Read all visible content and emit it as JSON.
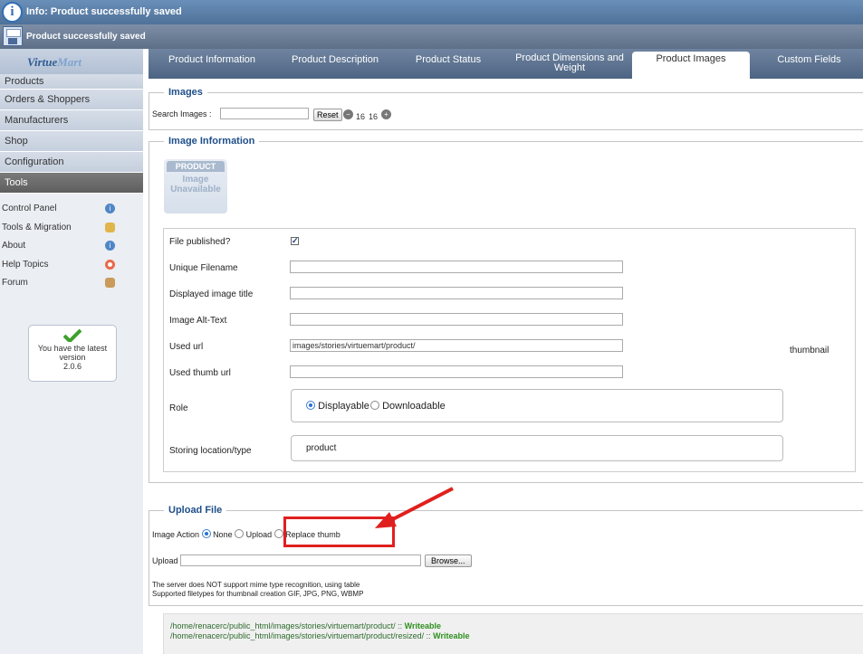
{
  "messages": {
    "info": "Info: Product successfully saved",
    "saved": "Product successfully saved"
  },
  "sidebar": {
    "logo_virtue": "Virtue",
    "logo_mart": "Mart",
    "menu": [
      "Products",
      "Orders & Shoppers",
      "Manufacturers",
      "Shop",
      "Configuration",
      "Tools"
    ],
    "active_menu": "Tools",
    "tools_items": [
      {
        "label": "Control Panel",
        "icon": "info-icon"
      },
      {
        "label": "Tools & Migration",
        "icon": "tools-icon"
      },
      {
        "label": "About",
        "icon": "info-icon"
      },
      {
        "label": "Help Topics",
        "icon": "lifebuoy-icon"
      },
      {
        "label": "Forum",
        "icon": "forum-icon"
      }
    ],
    "version_line1": "You have the latest",
    "version_line2": "version",
    "version_number": "2.0.6"
  },
  "tabs": [
    {
      "label": "Product Information"
    },
    {
      "label": "Product Description"
    },
    {
      "label": "Product Status"
    },
    {
      "label": "Product Dimensions and",
      "label2": "Weight"
    },
    {
      "label": "Product Images"
    },
    {
      "label": "Custom Fields"
    }
  ],
  "active_tab": "Product Images",
  "images": {
    "legend": "Images",
    "search_label": "Search Images :",
    "search_value": "",
    "reset_label": "Reset",
    "page_a": "16",
    "page_b": "16"
  },
  "image_info": {
    "legend": "Image Information",
    "placeholder_head": "PRODUCT",
    "placeholder_line1": "Image",
    "placeholder_line2": "Unavailable",
    "file_published_label": "File published?",
    "file_published_checked": true,
    "unique_filename_label": "Unique Filename",
    "unique_filename_value": "",
    "displayed_title_label": "Displayed image title",
    "displayed_title_value": "",
    "alt_text_label": "Image Alt-Text",
    "alt_text_value": "",
    "used_url_label": "Used url",
    "used_url_value": "images/stories/virtuemart/product/",
    "used_thumb_url_label": "Used thumb url",
    "used_thumb_url_value": "",
    "thumbnail_label": "thumbnail",
    "role_label": "Role",
    "role_options": [
      "Displayable",
      "Downloadable"
    ],
    "role_selected": "Displayable",
    "storing_label": "Storing location/type",
    "storing_value": "product"
  },
  "upload": {
    "legend": "Upload File",
    "image_action_label": "Image Action",
    "action_options": [
      "None",
      "Upload",
      "Replace thumb"
    ],
    "action_selected": "None",
    "upload_file_label": "Upload File",
    "browse_label": "Browse...",
    "note1": "The server does NOT support mime type recognition, using table",
    "note2": "Supported filetypes for thumbnail creation GIF, JPG, PNG, WBMP"
  },
  "paths": [
    {
      "path": "/home/renacerc/public_html/images/stories/virtuemart/product/ :: ",
      "status": "Writeable"
    },
    {
      "path": "/home/renacerc/public_html/images/stories/virtuemart/product/resized/ :: ",
      "status": "Writeable"
    }
  ],
  "colors": {
    "legend_blue": "#1f4f8a",
    "annotation_red": "#e0201e",
    "writeable_green": "#2f8f1f"
  }
}
